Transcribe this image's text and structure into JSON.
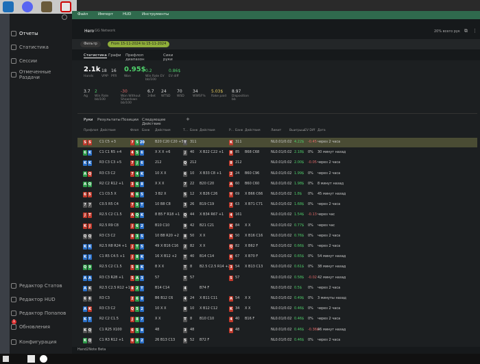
{
  "app": {
    "title": "Hand2Note Beta",
    "menu": [
      "Файл",
      "Импорт",
      "HUD",
      "Инструменты"
    ]
  },
  "sidebar": {
    "top": [
      "Отчеты",
      "Статистика",
      "Сессии",
      "Отмеченные Раздачи"
    ],
    "bottom": [
      "Редактор Статов",
      "Редактор HUD",
      "Редактор Попапов",
      "Обновления",
      "Конфигурация"
    ],
    "badge": "1"
  },
  "header": {
    "player": "Hero",
    "network": "GG Network",
    "hands_right": "20% всего рук"
  },
  "filters": {
    "add": "Фильтр",
    "date_range": "From 15-11-2024 to 15-11-2024"
  },
  "subtabs": [
    "Статистика",
    "Графи",
    "Префлоп диапазон",
    "Сики руки"
  ],
  "stats": [
    {
      "value": "2.1k",
      "label": "Hands"
    },
    {
      "value": "18",
      "label": "VPIP"
    },
    {
      "value": "16",
      "label": "PFR"
    },
    {
      "value": "0.95$",
      "label": "Won"
    },
    {
      "value": "0.2",
      "label": "Win Rate EV bb/100"
    },
    {
      "value": "0.86$",
      "label": "EV diff"
    }
  ],
  "stats2": [
    {
      "value": "3.7",
      "label": "Ag"
    },
    {
      "value": "2",
      "label": "Win Rate bb/100"
    },
    {
      "value": "-30",
      "label": "Won Without Showdown bb/100"
    },
    {
      "value": "6.7",
      "label": "3-Bet"
    },
    {
      "value": "24",
      "label": "WTSD"
    },
    {
      "value": "70",
      "label": "WSD"
    },
    {
      "value": "34",
      "label": "WWSF%"
    },
    {
      "value": "5.03$",
      "label": "Rake paid"
    },
    {
      "value": "8.97",
      "label": "Disposition bb"
    }
  ],
  "tabletabs": [
    "Руки",
    "Результаты",
    "Позиции",
    "Следующее Действие",
    "+"
  ],
  "columns": [
    "Префлоп",
    "Действия",
    "Флоп",
    "Банк",
    "Действия",
    "Т...",
    "Банк",
    "Действия",
    "Р...",
    "Банк",
    "Действия",
    "Лимит",
    "Выигрыш",
    "EV Diff",
    "Дата"
  ],
  "rows": [
    {
      "h": [
        "S",
        "S"
      ],
      "hc": [
        "r",
        "r"
      ],
      "pf": "C1 C5 +3",
      "f": [
        "7",
        "5",
        "20"
      ],
      "fa": "B20 C20 C20 +5",
      "t": "T",
      "tb": "311",
      "r": "K",
      "rb": "311",
      "lim": "NL0.01/0.02",
      "win": "4.22$",
      "ev": "-0.45",
      "date": "через 2 часа",
      "sel": true
    },
    {
      "h": [
        "6",
        "K"
      ],
      "hc": [
        "g",
        "b"
      ],
      "pf": "C1 C1 R5 +4",
      "f": [
        "4",
        "5",
        "6"
      ],
      "fa": "X X X +6",
      "t": "J",
      "tb": "40",
      "ta": "X B22 C22 +1",
      "r": "8",
      "rb": "85",
      "ra": "B68 C68",
      "lim": "NL0.01/0.02",
      "win": "2.18$",
      "ev": "0%",
      "date": "30 минут назад"
    },
    {
      "h": [
        "K",
        "K"
      ],
      "hc": [
        "b",
        "b"
      ],
      "pf": "R3 C3 C3 +5",
      "f": [
        "7",
        "J",
        "6"
      ],
      "fa": "212",
      "t": "Q",
      "tb": "212",
      "r": "8",
      "rb": "212",
      "lim": "NL0.01/0.02",
      "win": "2.00$",
      "ev": "-0.05",
      "date": "через 2 часа"
    },
    {
      "h": [
        "A",
        "Q"
      ],
      "hc": [
        "g",
        "r"
      ],
      "pf": "R3 C3 C2",
      "f": [
        "7",
        "4",
        "K"
      ],
      "fa": "10 X X",
      "t": "6",
      "tb": "10",
      "ta": "X B33 C8 +1",
      "r": "2",
      "rb": "24",
      "ra": "B60 C96",
      "lim": "NL0.01/0.02",
      "win": "1.99$",
      "ev": "0%",
      "date": "через 2 часа"
    },
    {
      "h": [
        "A",
        "Q"
      ],
      "hc": [
        "g",
        "g"
      ],
      "pf": "R2 C2 R12 +1",
      "f": [
        "3",
        "6",
        "8"
      ],
      "fa": "X X X",
      "t": "7",
      "tb": "22",
      "ta": "B20 C20",
      "r": "A",
      "rb": "60",
      "ra": "B60 C60",
      "lim": "NL0.01/0.02",
      "win": "1.98$",
      "ev": "0%",
      "date": "8 минут назад"
    },
    {
      "h": [
        "6",
        "5"
      ],
      "hc": [
        "r",
        "r"
      ],
      "pf": "C1 C0.5 X",
      "f": [
        "K",
        "6",
        "5"
      ],
      "fa": "3 B2 X",
      "t": "5",
      "tb": "12",
      "ta": "X B26 C26",
      "r": "T",
      "rb": "69",
      "ra": "X B66 C66",
      "lim": "NL0.01/0.02",
      "win": "1.8$",
      "ev": "0%",
      "date": "45 минут назад"
    },
    {
      "h": [
        "7",
        "7"
      ],
      "hc": [
        "k",
        "k"
      ],
      "pf": "C0.5 R5 C4",
      "f": [
        "7",
        "5",
        "T"
      ],
      "fa": "10 B8 C8",
      "t": "3",
      "tb": "26",
      "ta": "B19 C19",
      "r": "2",
      "rb": "63",
      "ra": "X B71 C71",
      "lim": "NL0.01/0.02",
      "win": "1.68$",
      "ev": "0%",
      "date": "через 2 часа"
    },
    {
      "h": [
        "J",
        "T"
      ],
      "hc": [
        "r",
        "r"
      ],
      "pf": "R2.5 C2 C1.5",
      "f": [
        "A",
        "Q",
        "K"
      ],
      "fa": "8 B5 F R18 +1",
      "t": "Q",
      "tb": "44",
      "ta": "X B34 R67 +1",
      "r": "4",
      "rb": "161",
      "lim": "NL0.01/0.02",
      "win": "1.54$",
      "ev": "-0.13",
      "date": "через час"
    },
    {
      "h": [
        "K",
        "J"
      ],
      "hc": [
        "r",
        "r"
      ],
      "pf": "R2.5 R9 C8",
      "f": [
        "J",
        "6",
        "2"
      ],
      "fa": "B10 C10",
      "t": "9",
      "tb": "42",
      "ta": "B21 C21",
      "r": "K",
      "rb": "84",
      "ra": "X X",
      "lim": "NL0.01/0.02",
      "win": "0.77$",
      "ev": "0%",
      "date": "через час"
    },
    {
      "h": [
        "Q",
        "Q"
      ],
      "hc": [
        "k",
        "k"
      ],
      "pf": "R3 C3 C2",
      "f": [
        "8",
        "3",
        "5"
      ],
      "fa": "10 B8 R20 +2",
      "t": "8",
      "tb": "50",
      "ta": "X X",
      "r": "K",
      "rb": "50",
      "ra": "X B16 C16",
      "lim": "NL0.01/0.02",
      "win": "0.76$",
      "ev": "0%",
      "date": "через 2 часа"
    },
    {
      "h": [
        "K",
        "K"
      ],
      "hc": [
        "b",
        "b"
      ],
      "pf": "R2.5 R8 R24 +1",
      "f": [
        "J",
        "T",
        "5"
      ],
      "fa": "49 X B16 C16",
      "t": "2",
      "tb": "82",
      "ta": "X X",
      "r": "Q",
      "rb": "82",
      "ra": "X B62 F",
      "lim": "NL0.01/0.02",
      "win": "0.66$",
      "ev": "0%",
      "date": "через 2 часа"
    },
    {
      "h": [
        "K",
        "J"
      ],
      "hc": [
        "b",
        "b"
      ],
      "pf": "C1 R5 C4.5 +1",
      "f": [
        "J",
        "8",
        "K"
      ],
      "fa": "16 X B12 +2",
      "t": "T",
      "tb": "40",
      "ta": "B14 C14",
      "r": "6",
      "rb": "67",
      "ra": "X B70 F",
      "lim": "NL0.01/0.02",
      "win": "0.65$",
      "ev": "0%",
      "date": "54 минут назад"
    },
    {
      "h": [
        "Q",
        "9"
      ],
      "hc": [
        "g",
        "g"
      ],
      "pf": "R2.5 C2 C1.5",
      "f": [
        "5",
        "8",
        "K"
      ],
      "fa": "8 X X",
      "t": "T",
      "tb": "8",
      "ta": "B2.5 C2.5 R14 +2",
      "r": "3",
      "rb": "54",
      "ra": "X B13 C13",
      "lim": "NL0.01/0.02",
      "win": "0.61$",
      "ev": "0%",
      "date": "38 минут назад"
    },
    {
      "h": [
        "A",
        "A"
      ],
      "hc": [
        "b",
        "b"
      ],
      "pf": "R3 C3 R28 +1",
      "f": [
        "5",
        "A",
        "3"
      ],
      "fa": "57",
      "t": "T",
      "tb": "57",
      "r": "5",
      "rb": "57",
      "lim": "NL0.01/0.02",
      "win": "0.58$",
      "ev": "-0.02",
      "date": "42 минут назад"
    },
    {
      "h": [
        "A",
        "K"
      ],
      "hc": [
        "b",
        "k"
      ],
      "pf": "R2.5 C2.5 R12 +1",
      "f": [
        "8",
        "2",
        "T"
      ],
      "fa": "B14 C14",
      "t": "4",
      "tb": "",
      "ta": "B74 F",
      "lim": "NL0.01/0.02",
      "win": "0.5$",
      "ev": "0%",
      "date": "через 2 часа"
    },
    {
      "h": [
        "6",
        "6"
      ],
      "hc": [
        "k",
        "k"
      ],
      "pf": "R3 C3",
      "f": [
        "2",
        "6",
        "8"
      ],
      "fa": "B6 B12 C6",
      "t": "4",
      "tb": "24",
      "ta": "X B11 C11",
      "r": "A",
      "rb": "54",
      "ra": "X X",
      "lim": "NL0.01/0.02",
      "win": "0.49$",
      "ev": "0%",
      "date": "3 минуты назад"
    },
    {
      "h": [
        "A",
        "K"
      ],
      "hc": [
        "b",
        "r"
      ],
      "pf": "R3 C3 C2",
      "f": [
        "Q",
        "5",
        "2"
      ],
      "fa": "10 X X",
      "t": "8",
      "tb": "10",
      "ta": "X B12 C12",
      "r": "K",
      "rb": "34",
      "ra": "X X",
      "lim": "NL0.01/0.02",
      "win": "0.46$",
      "ev": "0%",
      "date": "через 2 часа"
    },
    {
      "h": [
        "K",
        "T"
      ],
      "hc": [
        "b",
        "b"
      ],
      "pf": "R2 C2 C1.5",
      "f": [
        "J",
        "8",
        "7"
      ],
      "fa": "X X",
      "t": "T",
      "tb": "8",
      "ta": "B10 C10",
      "r": "4",
      "rb": "40",
      "ra": "B16 F",
      "lim": "NL0.01/0.02",
      "win": "0.46$",
      "ev": "0%",
      "date": "через 2 часа"
    },
    {
      "h": [
        "K",
        "Q"
      ],
      "hc": [
        "k",
        "k"
      ],
      "pf": "C1 R25 X100",
      "f": [
        "6",
        "5",
        "8"
      ],
      "fa": "48",
      "t": "3",
      "tb": "48",
      "r": "8",
      "rb": "48",
      "lim": "NL0.01/0.02",
      "win": "0.46$",
      "ev": "-0.36$",
      "date": "46 минут назад"
    },
    {
      "h": [
        "K",
        "Q"
      ],
      "hc": [
        "g",
        "k"
      ],
      "pf": "C1 R3 R12 +1",
      "f": [
        "6",
        "9",
        "2"
      ],
      "fa": "26 B13 C13",
      "t": "5",
      "tb": "52",
      "ta": "B72 F",
      "lim": "NL0.01/0.02",
      "win": "0.46$",
      "ev": "0%",
      "date": "через 2 часа"
    }
  ],
  "footer": {
    "label": "Hand2Note Beta"
  }
}
